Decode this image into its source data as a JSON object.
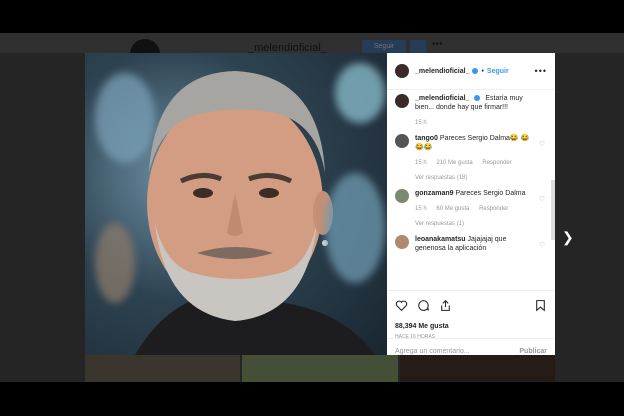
{
  "background": {
    "username": "_melendioficial_",
    "follow_label": "Seguir",
    "more": "•••"
  },
  "post": {
    "username": "_melendioficial_",
    "follow_label": "Seguir",
    "more": "•••",
    "likes": "88,394 Me gusta",
    "time_ago": "HACE 16 HORAS",
    "add_comment_placeholder": "Agrega un comentario...",
    "post_label": "Publicar"
  },
  "comments": [
    {
      "user": "_melendioficial_",
      "text": "Estaría muy bien... donde hay que firmar!!!",
      "time": "15 h",
      "likes": "",
      "reply": "",
      "replies": ""
    },
    {
      "user": "tango0",
      "text": "Pareces Sergio Dalma😂 😂😂😂",
      "time": "15 h",
      "likes": "210 Me gusta",
      "reply": "Responder",
      "replies": "Ver respuestas (18)"
    },
    {
      "user": "gonzaman9",
      "text": "Pareces Sergio Dalma",
      "time": "15 h",
      "likes": "60 Me gusta",
      "reply": "Responder",
      "replies": "Ver respuestas (1)"
    },
    {
      "user": "leoanakamatsu",
      "text": "Jajajajaj que genenosa la aplicación",
      "time": "",
      "likes": "",
      "reply": "",
      "replies": ""
    }
  ],
  "colors": {
    "accent": "#3897f0",
    "backdrop": "#000000"
  },
  "icons": [
    "heart-icon",
    "comment-icon",
    "share-icon",
    "bookmark-icon",
    "chevron-right-icon"
  ]
}
